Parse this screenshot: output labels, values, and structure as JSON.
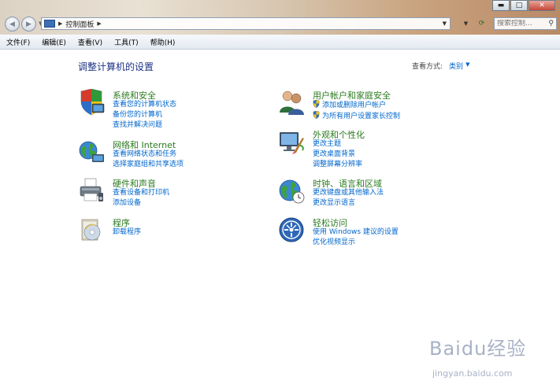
{
  "address": {
    "path": "控制面板"
  },
  "search": {
    "placeholder": "搜索控制..."
  },
  "menu": [
    "文件(F)",
    "编辑(E)",
    "查看(V)",
    "工具(T)",
    "帮助(H)"
  ],
  "page": {
    "heading": "调整计算机的设置",
    "viewby_label": "查看方式:",
    "viewby_value": "类别"
  },
  "categories": [
    {
      "title": "系统和安全",
      "icon": "shield-computer-icon",
      "links": [
        "查看您的计算机状态",
        "备份您的计算机",
        "查找并解决问题"
      ]
    },
    {
      "title": "网络和 Internet",
      "icon": "network-globe-icon",
      "links": [
        "查看网络状态和任务",
        "选择家庭组和共享选项"
      ]
    },
    {
      "title": "硬件和声音",
      "icon": "printer-icon",
      "links": [
        "查看设备和打印机",
        "添加设备"
      ]
    },
    {
      "title": "程序",
      "icon": "programs-icon",
      "links": [
        "卸载程序"
      ]
    },
    {
      "title": "用户帐户和家庭安全",
      "icon": "users-icon",
      "links": [
        "添加或删除用户帐户",
        "为所有用户设置家长控制"
      ]
    },
    {
      "title": "外观和个性化",
      "icon": "appearance-icon",
      "links": [
        "更改主题",
        "更改桌面背景",
        "调整屏幕分辨率"
      ]
    },
    {
      "title": "时钟、语言和区域",
      "icon": "clock-globe-icon",
      "links": [
        "更改键盘或其他输入法",
        "更改显示语言"
      ]
    },
    {
      "title": "轻松访问",
      "icon": "ease-of-access-icon",
      "links": [
        "使用 Windows 建议的设置",
        "优化视频显示"
      ]
    }
  ],
  "watermark": {
    "title": "Baidu经验",
    "url": "jingyan.baidu.com"
  },
  "colors": {
    "link": "#0066cc",
    "category_title": "#2a7a1e",
    "heading": "#1e3287"
  }
}
